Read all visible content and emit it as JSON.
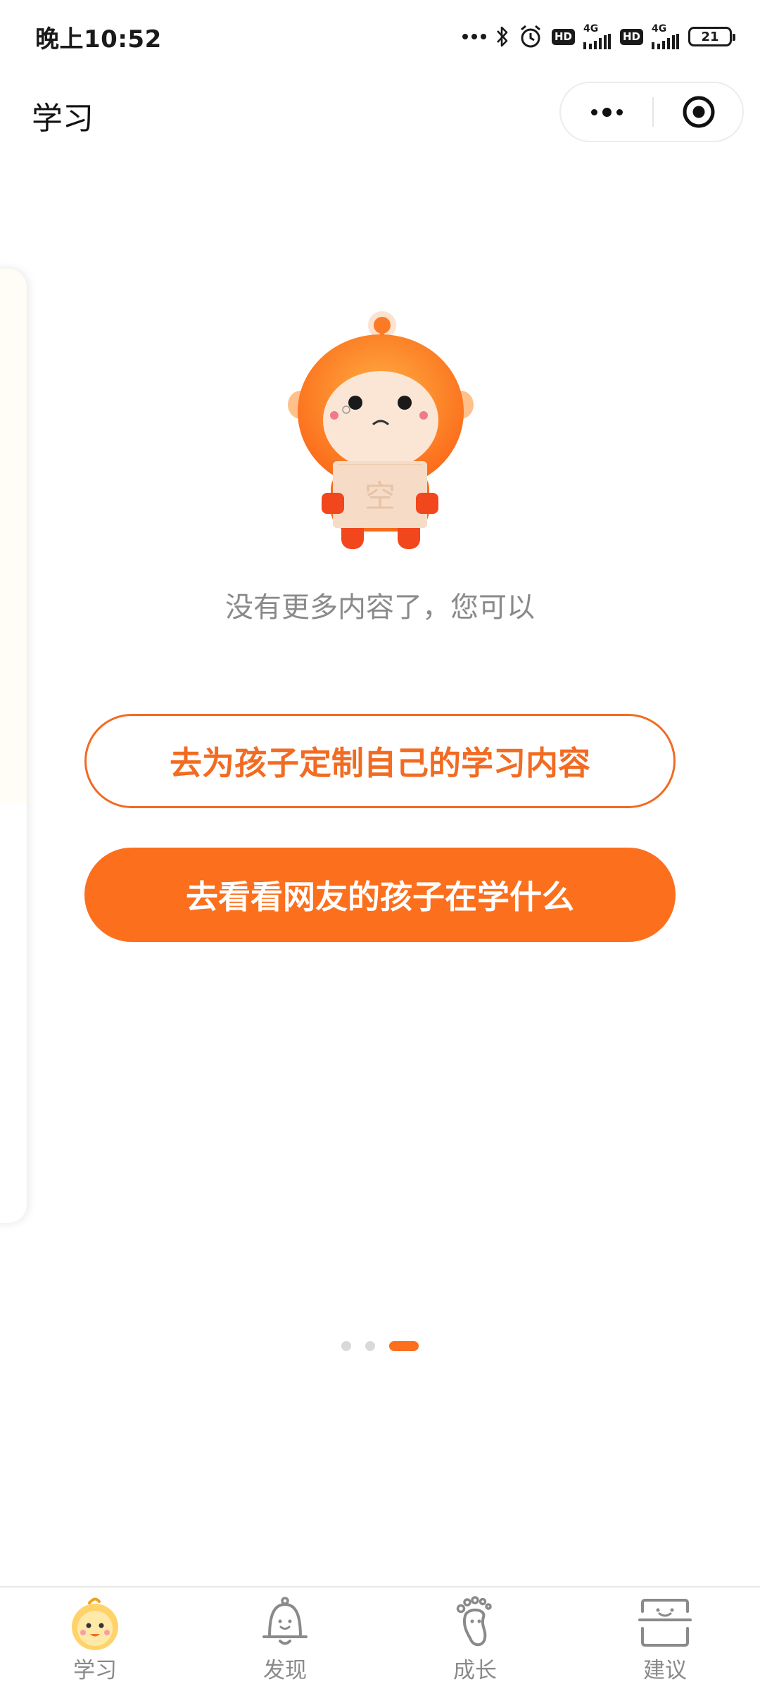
{
  "status_bar": {
    "time": "晚上10:52",
    "network_label_1": "4G",
    "network_label_2": "4G",
    "hd_label_1": "HD",
    "hd_label_2": "HD",
    "battery": "21"
  },
  "nav": {
    "title": "学习"
  },
  "empty_state": {
    "mascot_box_text": "空",
    "message": "没有更多内容了，您可以"
  },
  "actions": {
    "customize_label": "去为孩子定制自己的学习内容",
    "browse_label": "去看看网友的孩子在学什么"
  },
  "pagination": {
    "total": 3,
    "active_index": 3
  },
  "tabs": [
    {
      "label": "学习",
      "icon": "baby-face-icon",
      "active": true
    },
    {
      "label": "发现",
      "icon": "bell-face-icon",
      "active": false
    },
    {
      "label": "成长",
      "icon": "footprint-icon",
      "active": false
    },
    {
      "label": "建议",
      "icon": "scan-face-icon",
      "active": false
    }
  ],
  "colors": {
    "accent": "#fb6f1d",
    "text_muted": "#8a8a8a"
  }
}
